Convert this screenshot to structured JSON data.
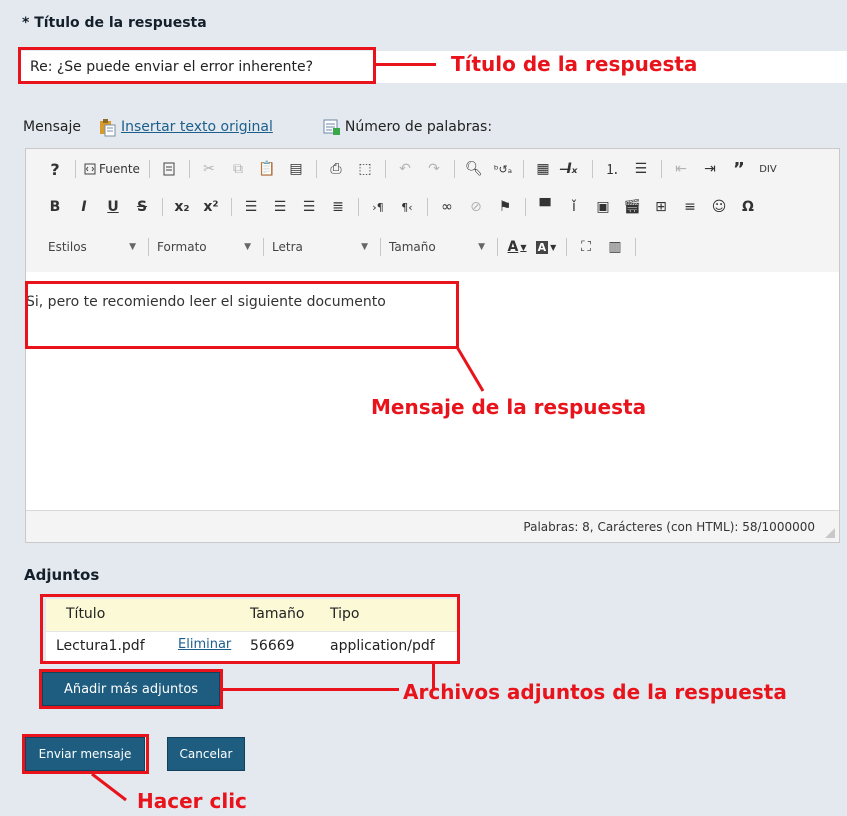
{
  "form": {
    "title_label": "* Título de la respuesta",
    "title_value": "Re: ¿Se puede enviar el error inherente?",
    "message_label": "Mensaje",
    "insert_original_link": "Insertar texto original",
    "word_count_label": "Número de palabras:"
  },
  "toolbar": {
    "row1": {
      "help": "?",
      "source": "Fuente"
    },
    "row3": {
      "styles": "Estilos",
      "format": "Formato",
      "font": "Letra",
      "size": "Tamaño"
    }
  },
  "editor": {
    "content": "Si, pero te recomiendo leer el siguiente documento",
    "status": "Palabras: 8, Carácteres (con HTML): 58/1000000"
  },
  "attachments": {
    "label": "Adjuntos",
    "headers": [
      "Título",
      "Tamaño",
      "Tipo"
    ],
    "rows": [
      {
        "title": "Lectura1.pdf",
        "action": "Eliminar",
        "size": "56669",
        "type": "application/pdf"
      }
    ],
    "add_more": "Añadir más adjuntos"
  },
  "actions": {
    "send": "Enviar mensaje",
    "cancel": "Cancelar"
  },
  "annotations": {
    "title": "Título de la respuesta",
    "message": "Mensaje de la respuesta",
    "attachments": "Archivos adjuntos de la respuesta",
    "click": "Hacer clic"
  },
  "colors": {
    "annotation": "#e8131b",
    "button": "#1e5d80",
    "link": "#1c5f8d",
    "page_bg": "#e3e9ee"
  }
}
